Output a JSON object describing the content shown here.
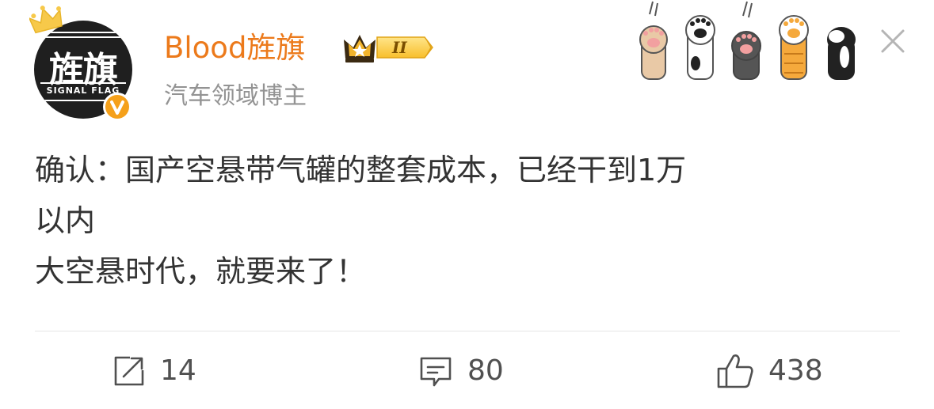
{
  "user": {
    "avatar_text": "旌旗",
    "avatar_sub": "SIGNAL FLAG",
    "name": "Blood旌旗",
    "vip_level": "II",
    "description": "汽车领域博主"
  },
  "post": {
    "lines": [
      "确认：国产空悬带气罐的整套成本，已经干到1万",
      "以内",
      "大空悬时代，就要来了！"
    ]
  },
  "actions": {
    "repost_count": "14",
    "comment_count": "80",
    "like_count": "438"
  },
  "colors": {
    "username": "#ec7a1b",
    "subtitle": "#939393",
    "text": "#333333",
    "verified": "#f5a01a",
    "icon": "#505050"
  },
  "icons": {
    "crown": "crown-icon",
    "verified": "verified-icon",
    "vip": "vip-crown-badge",
    "close": "close-icon",
    "repost": "repost-icon",
    "comment": "comment-icon",
    "like": "thumbs-up-icon",
    "decoration": "cat-paws-icon"
  }
}
